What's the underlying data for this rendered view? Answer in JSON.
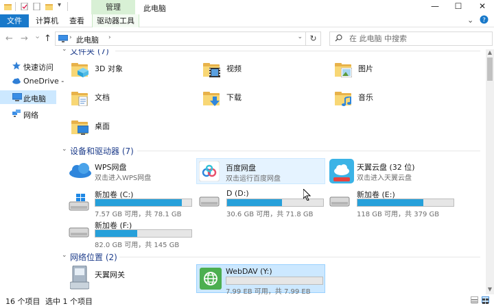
{
  "window": {
    "title": "此电脑",
    "context_tab": "管理",
    "minimize": "—",
    "maximize": "☐",
    "close": "✕"
  },
  "ribbon": {
    "file_tab": "文件",
    "tabs": [
      "计算机",
      "查看",
      "驱动器工具"
    ],
    "collapse_icon": "chevron-down-icon",
    "help_icon": "help-icon"
  },
  "nav": {
    "back": "←",
    "forward": "→",
    "history": "⌄",
    "up": "↑",
    "address": "此电脑",
    "address_separator": "›",
    "refresh": "↻",
    "search_placeholder": "在 此电脑 中搜索"
  },
  "sidebar": {
    "items": [
      {
        "label": "快速访问",
        "icon": "star-icon"
      },
      {
        "label": "OneDrive -",
        "icon": "cloud-icon"
      },
      {
        "label": "此电脑",
        "icon": "computer-icon"
      },
      {
        "label": "网络",
        "icon": "network-icon"
      }
    ]
  },
  "groups": {
    "folders": {
      "title": "文件夹 (7)"
    },
    "devices": {
      "title": "设备和驱动器 (7)"
    },
    "network": {
      "title": "网络位置 (2)"
    }
  },
  "folders": [
    {
      "name": "3D 对象",
      "icon": "3d-objects-folder-icon"
    },
    {
      "name": "视频",
      "icon": "videos-folder-icon"
    },
    {
      "name": "图片",
      "icon": "pictures-folder-icon"
    },
    {
      "name": "文档",
      "icon": "documents-folder-icon"
    },
    {
      "name": "下载",
      "icon": "downloads-folder-icon"
    },
    {
      "name": "音乐",
      "icon": "music-folder-icon"
    },
    {
      "name": "桌面",
      "icon": "desktop-folder-icon"
    }
  ],
  "cloud_drives": [
    {
      "name": "WPS网盘",
      "sub": "双击进入WPS网盘",
      "icon": "wps-cloud-icon"
    },
    {
      "name": "百度网盘",
      "sub": "双击运行百度网盘",
      "icon": "baidu-netdisk-icon"
    },
    {
      "name": "天翼云盘 (32 位)",
      "sub": "双击进入天翼云盘",
      "icon": "tianyi-cloud-icon"
    }
  ],
  "drives": [
    {
      "name": "新加卷 (C:)",
      "free": "7.57 GB 可用，共 78.1 GB",
      "used_fraction": 0.903,
      "icon": "windows-drive-icon"
    },
    {
      "name": "D (D:)",
      "free": "30.6 GB 可用，共 71.8 GB",
      "used_fraction": 0.574,
      "icon": "hard-drive-icon"
    },
    {
      "name": "新加卷 (E:)",
      "free": "118 GB 可用，共 379 GB",
      "used_fraction": 0.689,
      "icon": "hard-drive-icon"
    },
    {
      "name": "新加卷 (F:)",
      "free": "82.0 GB 可用，共 145 GB",
      "used_fraction": 0.434,
      "icon": "hard-drive-icon"
    }
  ],
  "network_locations": [
    {
      "name": "天翼网关",
      "icon": "media-device-icon"
    },
    {
      "name": "WebDAV (Y:)",
      "free": "7.99 EB 可用，共 7.99 EB",
      "used_fraction": 0.0,
      "icon": "webdav-globe-icon"
    }
  ],
  "status": {
    "count": "16 个项目",
    "selected": "选中 1 个项目"
  },
  "colors": {
    "accent": "#1979ca",
    "bar_fill": "#26a0da",
    "group_title": "#1e3d8b",
    "context_tab": "#d8f0d5",
    "selection": "#cce8ff"
  }
}
